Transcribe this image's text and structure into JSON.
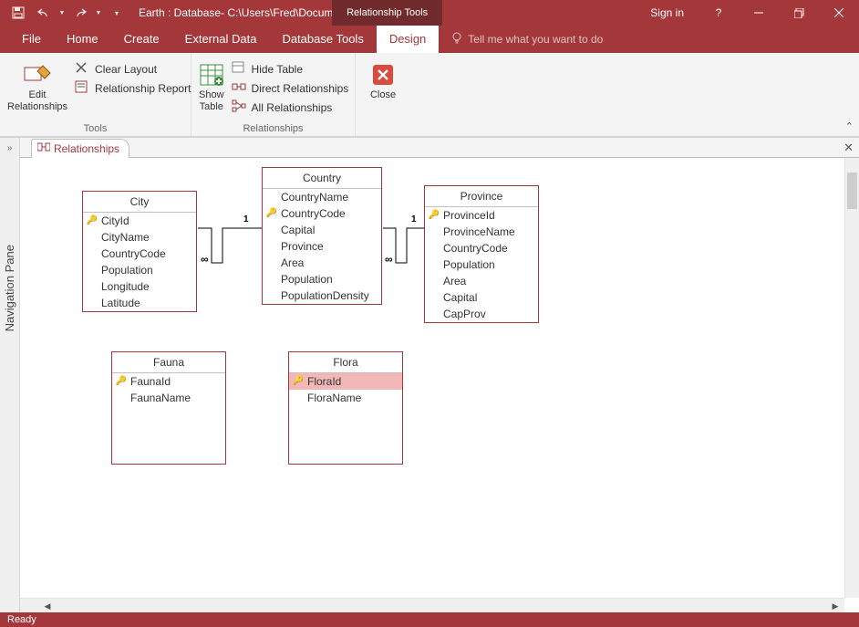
{
  "titlebar": {
    "title": "Earth : Database- C:\\Users\\Fred\\Docume...",
    "context_tool": "Relationship Tools",
    "signin": "Sign in"
  },
  "tabs": {
    "file": "File",
    "home": "Home",
    "create": "Create",
    "external": "External Data",
    "dbtools": "Database Tools",
    "design": "Design",
    "tellme": "Tell me what you want to do"
  },
  "ribbon": {
    "edit_rel": "Edit\nRelationships",
    "clear_layout": "Clear Layout",
    "rel_report": "Relationship Report",
    "show_table": "Show\nTable",
    "hide_table": "Hide Table",
    "direct_rel": "Direct Relationships",
    "all_rel": "All Relationships",
    "close": "Close",
    "group_tools": "Tools",
    "group_rel": "Relationships"
  },
  "navpane_label": "Navigation Pane",
  "doctab": "Relationships",
  "tables": {
    "city": {
      "title": "City",
      "fields": [
        "CityId",
        "CityName",
        "CountryCode",
        "Population",
        "Longitude",
        "Latitude"
      ],
      "keyIndex": 0
    },
    "country": {
      "title": "Country",
      "fields": [
        "CountryName",
        "CountryCode",
        "Capital",
        "Province",
        "Area",
        "Population",
        "PopulationDensity"
      ],
      "keyIndex": 1
    },
    "province": {
      "title": "Province",
      "fields": [
        "ProvinceId",
        "ProvinceName",
        "CountryCode",
        "Population",
        "Area",
        "Capital",
        "CapProv"
      ],
      "keyIndex": 0
    },
    "fauna": {
      "title": "Fauna",
      "fields": [
        "FaunaId",
        "FaunaName"
      ],
      "keyIndex": 0
    },
    "flora": {
      "title": "Flora",
      "fields": [
        "FloraId",
        "FloraName"
      ],
      "keyIndex": 0,
      "selected": 0
    }
  },
  "status": "Ready",
  "rel_labels": {
    "one": "1",
    "many": "∞"
  }
}
